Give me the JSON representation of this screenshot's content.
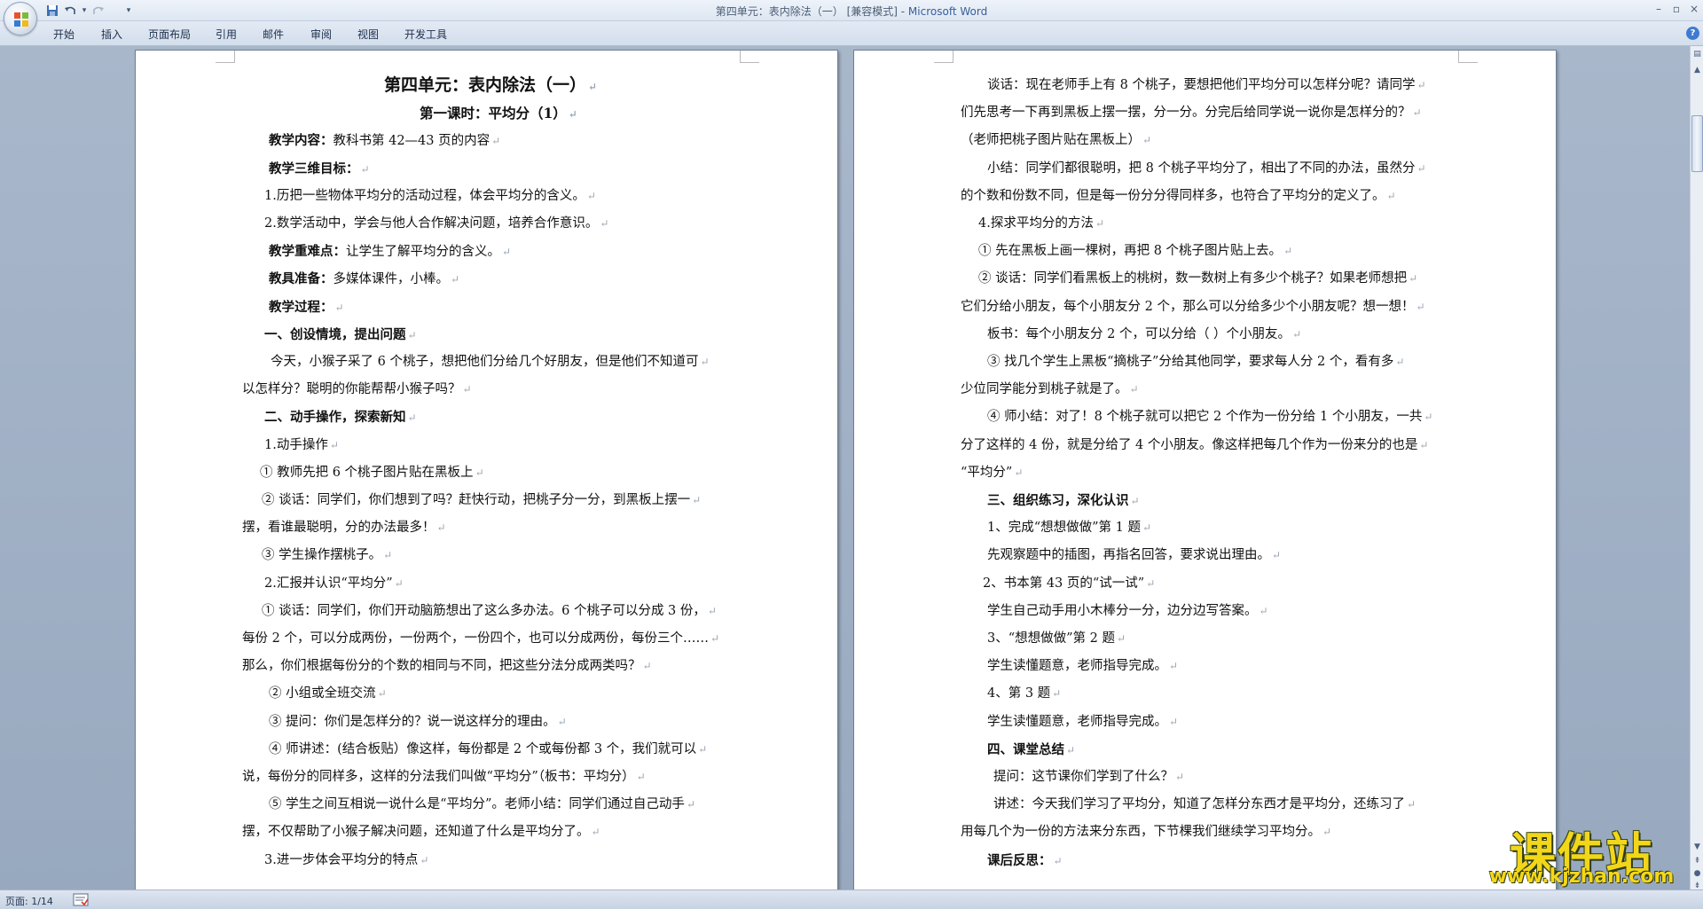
{
  "window": {
    "title": "第四单元：表内除法（一） [兼容模式] - ",
    "app_name": "Microsoft Word"
  },
  "quick_access": {
    "save_icon": "save-icon",
    "undo_icon": "undo-icon",
    "redo_icon": "redo-icon",
    "customize_icon": "qat-dropdown-icon"
  },
  "ribbon": {
    "tabs": [
      "开始",
      "插入",
      "页面布局",
      "引用",
      "邮件",
      "审阅",
      "视图",
      "开发工具"
    ]
  },
  "document": {
    "left_page": [
      {
        "text": "第四单元：表内除法（一）",
        "style": "h1"
      },
      {
        "text": "第一课时：平均分（1）",
        "style": "h2"
      },
      {
        "label": "教学内容：",
        "text": "教科书第 42—43 页的内容"
      },
      {
        "label": "教学三维目标：",
        "text": ""
      },
      {
        "text": "1.历把一些物体平均分的活动过程，体会平均分的含义。"
      },
      {
        "text": "2.数学活动中，学会与他人合作解决问题，培养合作意识。"
      },
      {
        "label": "教学重难点：",
        "text": "让学生了解平均分的含义。"
      },
      {
        "label": "教具准备：",
        "text": "多媒体课件，小棒。"
      },
      {
        "label": "教学过程：",
        "text": ""
      },
      {
        "label": "一、创设情境，提出问题",
        "text": ""
      },
      {
        "text": "今天，小猴子采了 6 个桃子，想把他们分给几个好朋友，但是他们不知道可"
      },
      {
        "text": "以怎样分？聪明的你能帮帮小猴子吗？"
      },
      {
        "label": "二、动手操作，探索新知",
        "text": ""
      },
      {
        "text": "1.动手操作"
      },
      {
        "text": "① 教师先把 6 个桃子图片贴在黑板上"
      },
      {
        "text": "② 谈话：同学们，你们想到了吗？赶快行动，把桃子分一分，到黑板上摆一"
      },
      {
        "text": "摆，看谁最聪明，分的办法最多！"
      },
      {
        "text": "③ 学生操作摆桃子。"
      },
      {
        "text": "2.汇报并认识“平均分”"
      },
      {
        "text": "① 谈话：同学们，你们开动脑筋想出了这么多办法。6 个桃子可以分成 3 份，"
      },
      {
        "text": "每份 2 个，可以分成两份，一份两个，一份四个，也可以分成两份，每份三个……"
      },
      {
        "text": "那么，你们根据每份分的个数的相同与不同，把这些分法分成两类吗？"
      },
      {
        "text": "② 小组或全班交流"
      },
      {
        "text": "③ 提问：你们是怎样分的？说一说这样分的理由。"
      },
      {
        "text": "④ 师讲述：(结合板贴）像这样，每份都是 2 个或每份都 3 个，我们就可以"
      },
      {
        "text": "说，每份分的同样多，这样的分法我们叫做“平均分”（板书：平均分）"
      },
      {
        "text": "⑤ 学生之间互相说一说什么是“平均分”。老师小结：同学们通过自己动手"
      },
      {
        "text": "摆，不仅帮助了小猴子解决问题，还知道了什么是平均分了。"
      },
      {
        "text": "3.进一步体会平均分的特点"
      }
    ],
    "right_page": [
      {
        "text": "谈话：现在老师手上有 8 个桃子，要想把他们平均分可以怎样分呢？请同学"
      },
      {
        "text": "们先思考一下再到黑板上摆一摆，分一分。分完后给同学说一说你是怎样分的？"
      },
      {
        "text": "（老师把桃子图片贴在黑板上）"
      },
      {
        "text": "小结：同学们都很聪明，把 8 个桃子平均分了，相出了不同的办法，虽然分"
      },
      {
        "text": "的个数和份数不同，但是每一份分分得同样多，也符合了平均分的定义了。"
      },
      {
        "text": "4.探求平均分的方法"
      },
      {
        "text": "① 先在黑板上画一棵树，再把 8 个桃子图片贴上去。"
      },
      {
        "text": "② 谈话：同学们看黑板上的桃树，数一数树上有多少个桃子？如果老师想把"
      },
      {
        "text": "它们分给小朋友，每个小朋友分 2 个，那么可以分给多少个小朋友呢？想一想！"
      },
      {
        "text": "板书：每个小朋友分 2 个，可以分给（  ）个小朋友。"
      },
      {
        "text": "③ 找几个学生上黑板“摘桃子”分给其他同学，要求每人分 2 个，看有多"
      },
      {
        "text": "少位同学能分到桃子就是了。"
      },
      {
        "text": "④ 师小结：对了！8 个桃子就可以把它 2 个作为一份分给 1 个小朋友，一共"
      },
      {
        "text": "分了这样的 4 份，就是分给了 4 个小朋友。像这样把每几个作为一份来分的也是"
      },
      {
        "text": "“平均分”"
      },
      {
        "label": "三、组织练习，深化认识",
        "text": ""
      },
      {
        "text": "1、完成“想想做做”第 1 题"
      },
      {
        "text": "先观察题中的插图，再指名回答，要求说出理由。"
      },
      {
        "text": "2、书本第 43 页的“试一试”"
      },
      {
        "text": "学生自己动手用小木棒分一分，边分边写答案。"
      },
      {
        "text": "3、“想想做做”第 2 题"
      },
      {
        "text": "学生读懂题意，老师指导完成。"
      },
      {
        "text": "4、第 3 题"
      },
      {
        "text": "学生读懂题意，老师指导完成。"
      },
      {
        "label": "四、课堂总结",
        "text": ""
      },
      {
        "text": "提问：这节课你们学到了什么？"
      },
      {
        "text": "讲述：今天我们学习了平均分，知道了怎样分东西才是平均分，还练习了"
      },
      {
        "text": "用每几个为一份的方法来分东西，下节棵我们继续学习平均分。"
      },
      {
        "label": "课后反思：",
        "text": ""
      }
    ]
  },
  "status_bar": {
    "page_info": "页面: 1/14"
  },
  "watermark": {
    "title": "课件站",
    "url": "www.kjzhan.com"
  },
  "colors": {
    "workspace": "#9aabc1",
    "ribbon": "#d3deec",
    "watermark_yellow": "#f2d61a"
  }
}
